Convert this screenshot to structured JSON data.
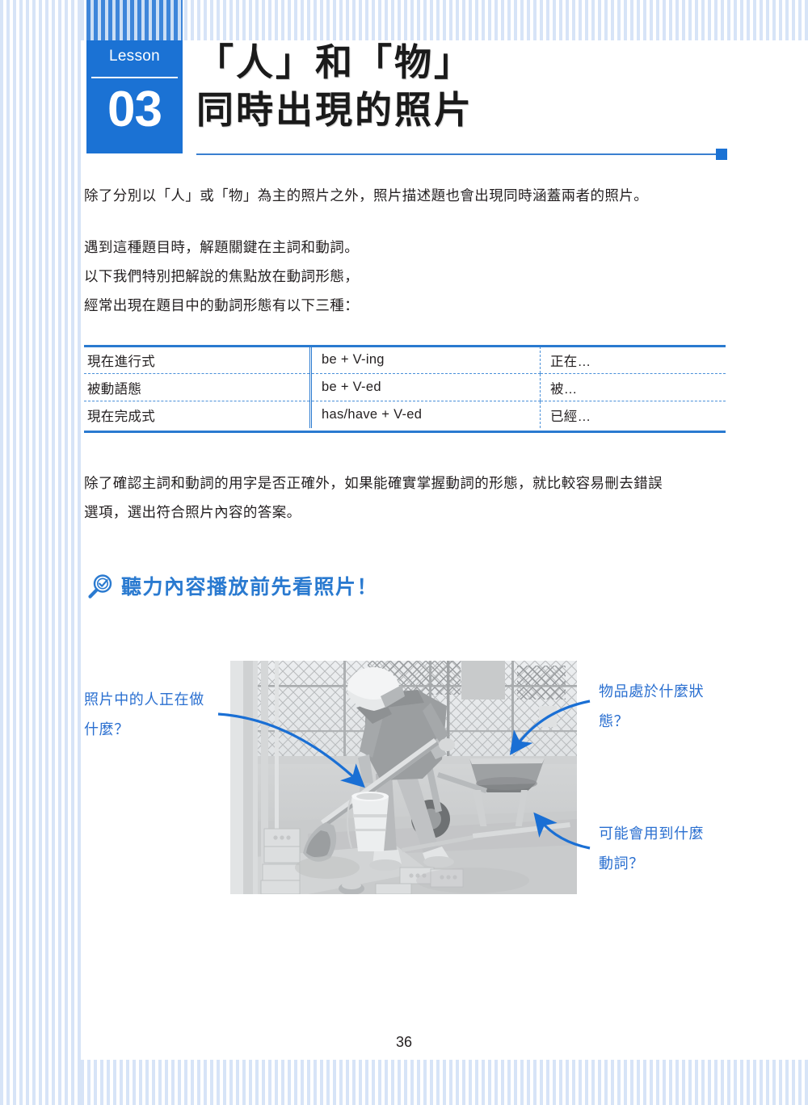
{
  "lesson_badge": {
    "label": "Lesson",
    "number": "03"
  },
  "title": {
    "line1": "「人」和「物」",
    "line2": "同時出現的照片"
  },
  "body": {
    "paragraph_1": "除了分別以「人」或「物」為主的照片之外，照片描述題也會出現同時涵蓋兩者的照片。",
    "paragraph_2_line1": "遇到這種題目時，解題關鍵在主詞和動詞。",
    "paragraph_2_line2": "以下我們特別把解說的焦點放在動詞形態，",
    "paragraph_2_line3": "經常出現在題目中的動詞形態有以下三種：",
    "paragraph_3_line1": "除了確認主詞和動詞的用字是否正確外，如果能確實掌握動詞的形態，就比較容易刪去錯誤",
    "paragraph_3_line2": "選項，選出符合照片內容的答案。"
  },
  "grammar_table": {
    "rows": [
      {
        "name": "現在進行式",
        "form": "be + V-ing",
        "meaning": "正在…"
      },
      {
        "name": "被動語態",
        "form": "be + V-ed",
        "meaning": "被…"
      },
      {
        "name": "現在完成式",
        "form": "has/have + V-ed",
        "meaning": "已經…"
      }
    ]
  },
  "callout": {
    "icon": "magnifier-check-icon",
    "text": "聽力內容播放前先看照片！"
  },
  "annotations": {
    "left_line1": "照片中的人正在做",
    "left_line2": "什麼？",
    "top_right_line1": "物品處於什麼狀",
    "top_right_line2": "態？",
    "bottom_right_line1": "可能會用到什麼",
    "bottom_right_line2": "動詞？"
  },
  "photo": {
    "description": "工人戴安全帽以鏟子鏟水泥，旁邊有水桶、手推車、磚塊與鐵絲網圍籬"
  },
  "page_number": "36",
  "colors": {
    "accent_blue": "#1b72d4",
    "rule_blue": "#2a7ad0",
    "annotation_blue": "#2a6fd0",
    "stripe_blue": "#d7e4f7"
  }
}
